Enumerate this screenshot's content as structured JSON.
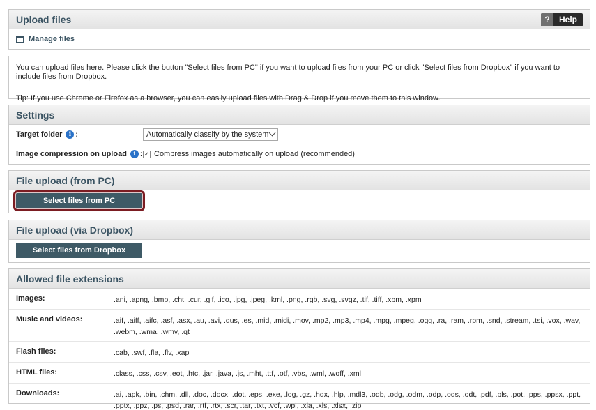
{
  "upload": {
    "title": "Upload files",
    "help_q": "?",
    "help_label": "Help",
    "manage_files": "Manage files"
  },
  "info": {
    "line1": "You can upload files here. Please click the button \"Select files from PC\" if you want to upload files from your PC or click \"Select files from Dropbox\" if you want to include files from Dropbox.",
    "line2": "Tip: If you use Chrome or Firefox as a browser, you can easily upload files with Drag & Drop if you move them to this window."
  },
  "settings": {
    "title": "Settings",
    "target_folder_label": "Target folder",
    "target_folder_value": "Automatically classify by the system",
    "compression_label": "Image compression on upload",
    "compression_checkbox": "Compress images automatically on upload (recommended)",
    "compression_checked": true,
    "colon": ":"
  },
  "pc_upload": {
    "title": "File upload (from PC)",
    "button": "Select files from PC"
  },
  "dropbox_upload": {
    "title": "File upload (via Dropbox)",
    "button": "Select files from Dropbox"
  },
  "extensions": {
    "title": "Allowed file extensions",
    "rows": [
      {
        "label": "Images:",
        "value": ".ani, .apng, .bmp, .cht, .cur, .gif, .ico, .jpg, .jpeg, .kml, .png, .rgb, .svg, .svgz, .tif, .tiff, .xbm, .xpm"
      },
      {
        "label": "Music and videos:",
        "value": ".aif, .aiff, .aifc, .asf, .asx, .au, .avi, .dus, .es, .mid, .midi, .mov, .mp2, .mp3, .mp4, .mpg, .mpeg, .ogg, .ra, .ram, .rpm, .snd, .stream, .tsi, .vox, .wav, .webm, .wma, .wmv, .qt"
      },
      {
        "label": "Flash files:",
        "value": ".cab, .swf, .fla, .flv, .xap"
      },
      {
        "label": "HTML files:",
        "value": ".class, .css, .csv, .eot, .htc, .jar, .java, .js, .mht, .ttf, .otf, .vbs, .wml, .woff, .xml"
      },
      {
        "label": "Downloads:",
        "value": ".ai, .apk, .bin, .chm, .dll, .doc, .docx, .dot, .eps, .exe, .log, .gz, .hqx, .hlp, .mdl3, .odb, .odg, .odm, .odp, .ods, .odt, .pdf, .pls, .pot, .pps, .ppsx, .ppt, .pptx, .ppz, .ps, .psd, .rar, .rtf, .rtx, .scr, .tar, .txt, .vcf, .wpl, .xla, .xls, .xlsx, .zip"
      }
    ]
  }
}
